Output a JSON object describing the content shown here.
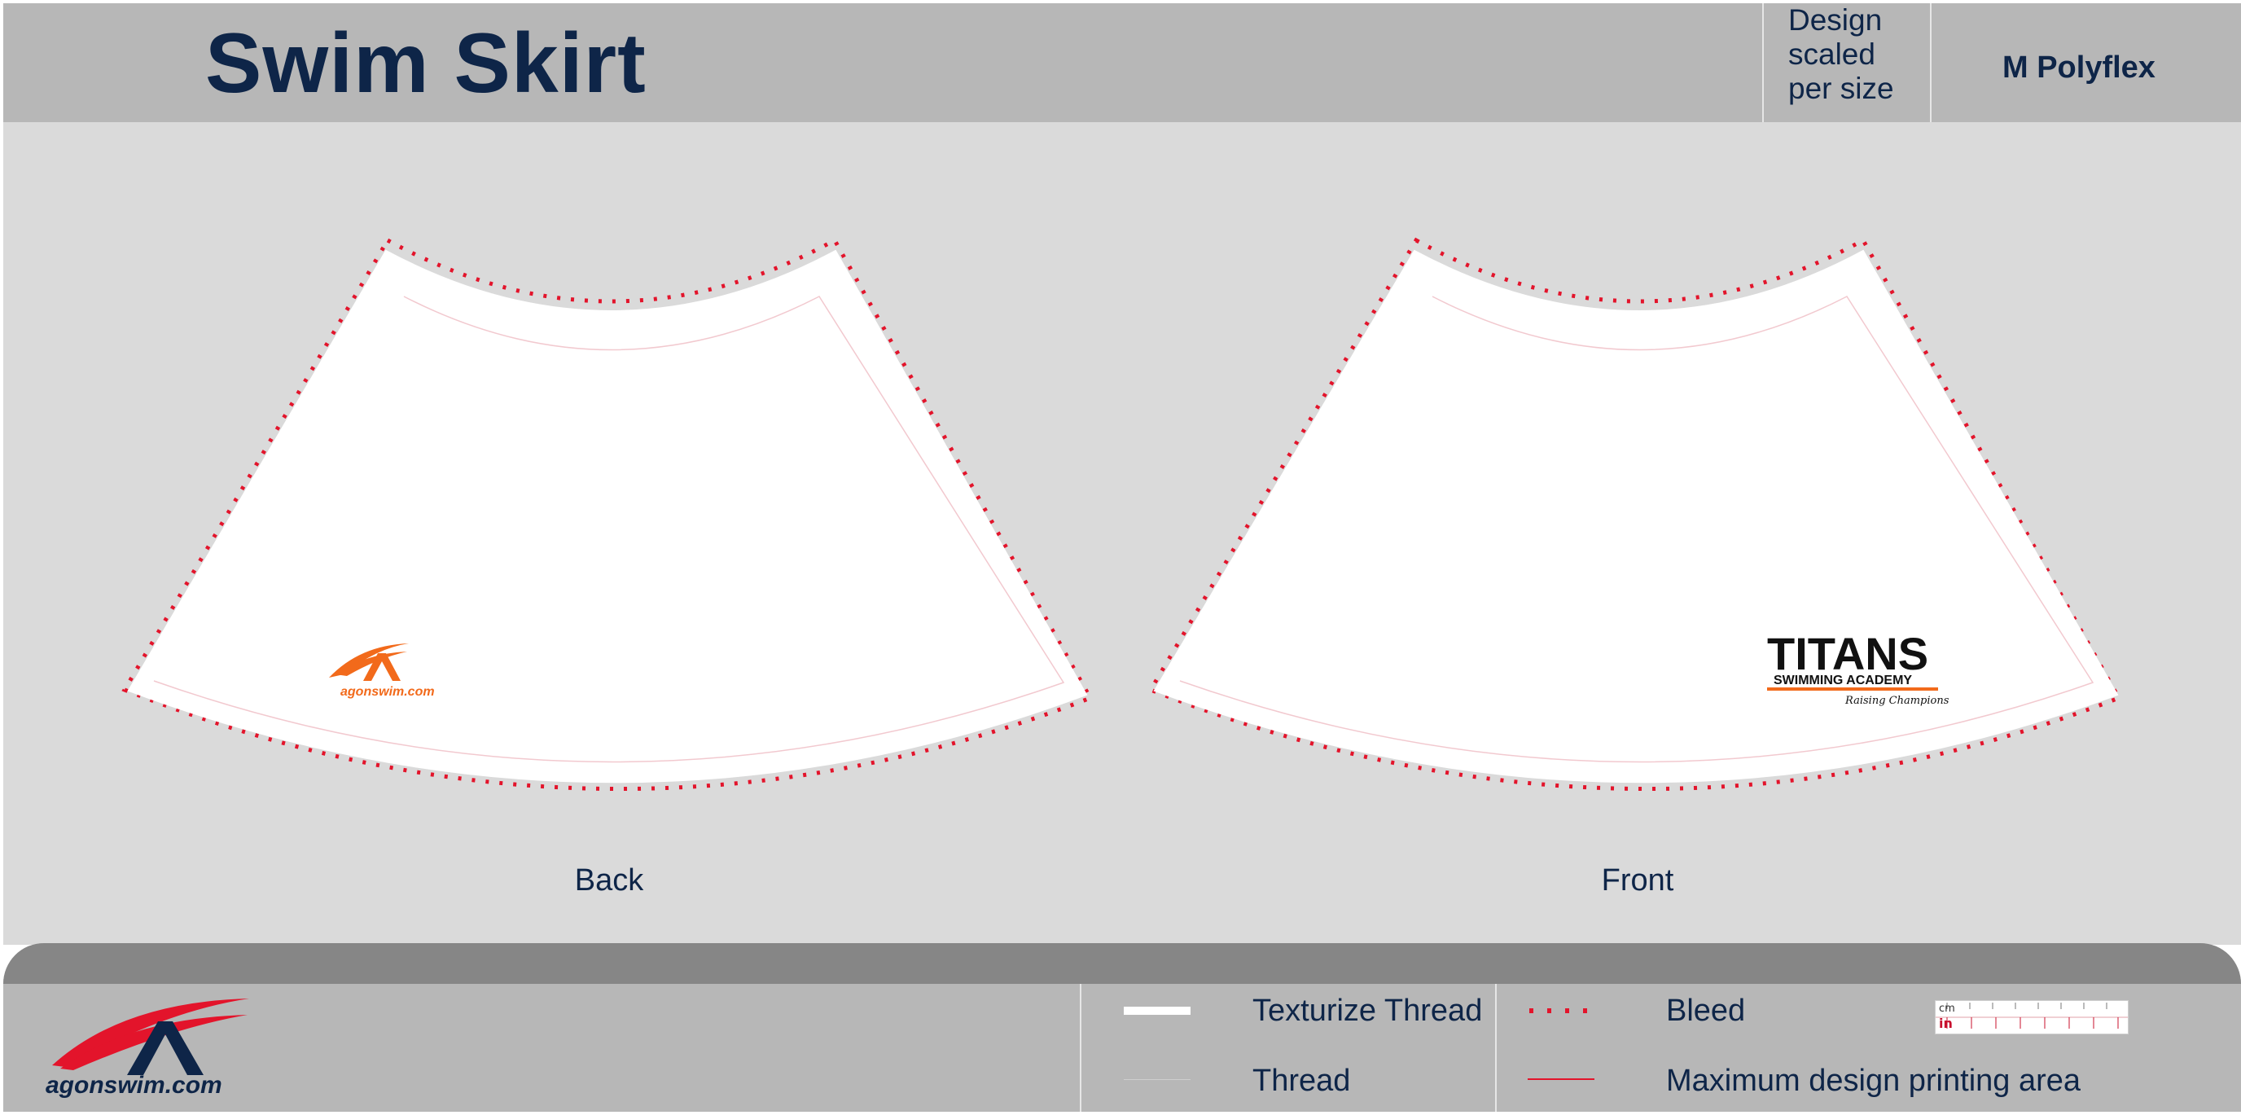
{
  "header": {
    "title": "Swim Skirt",
    "design_note": "Design\nscaled\nper size",
    "size_fabric": "M Polyflex"
  },
  "panels": {
    "back": {
      "label": "Back",
      "logo_text": "agonswim.com"
    },
    "front": {
      "label": "Front",
      "logo_main": "TITANS",
      "logo_sub": "SWIMMING ACADEMY",
      "logo_script": "Raising Champions"
    }
  },
  "footer": {
    "brand_text": "agonswim.com",
    "legend": {
      "texturize_thread": "Texturize Thread",
      "thread": "Thread",
      "bleed": "Bleed",
      "max_area": "Maximum design printing area"
    },
    "ruler": {
      "cm_label": "cm",
      "in_label": "in"
    }
  },
  "colors": {
    "navy": "#0e2548",
    "bleed_red": "#e3142b",
    "orange": "#f26a1b",
    "header_gray": "#b7b7b7",
    "canvas_gray": "#dadada"
  }
}
